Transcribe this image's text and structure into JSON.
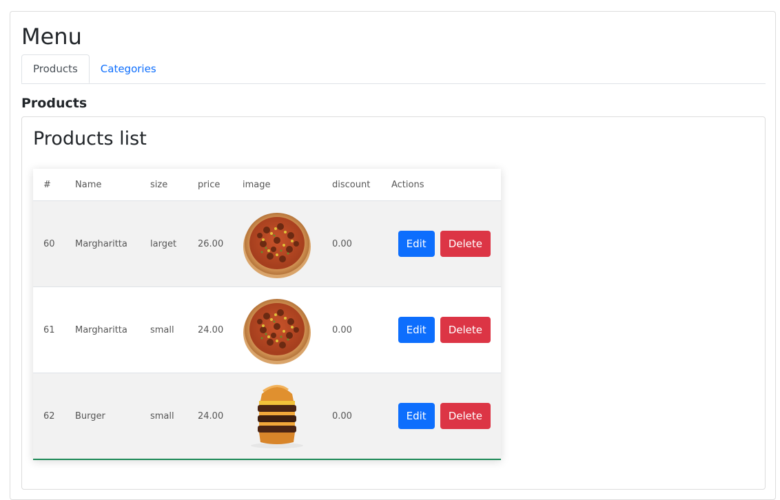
{
  "page": {
    "title": "Menu"
  },
  "tabs": [
    {
      "label": "Products",
      "active": true
    },
    {
      "label": "Categories",
      "active": false
    }
  ],
  "section": {
    "title": "Products"
  },
  "list": {
    "title": "Products list",
    "columns": [
      "#",
      "Name",
      "size",
      "price",
      "image",
      "discount",
      "Actions"
    ],
    "rows": [
      {
        "id": "60",
        "name": "Margharitta",
        "size": "larget",
        "price": "26.00",
        "image": "pizza-image",
        "discount": "0.00",
        "edit_label": "Edit",
        "delete_label": "Delete"
      },
      {
        "id": "61",
        "name": "Margharitta",
        "size": "small",
        "price": "24.00",
        "image": "pizza-image",
        "discount": "0.00",
        "edit_label": "Edit",
        "delete_label": "Delete"
      },
      {
        "id": "62",
        "name": "Burger",
        "size": "small",
        "price": "24.00",
        "image": "burger-image",
        "discount": "0.00",
        "edit_label": "Edit",
        "delete_label": "Delete"
      }
    ]
  },
  "colors": {
    "primary": "#0d6efd",
    "danger": "#dc3545",
    "success": "#198754",
    "stripe": "#f2f2f2"
  }
}
